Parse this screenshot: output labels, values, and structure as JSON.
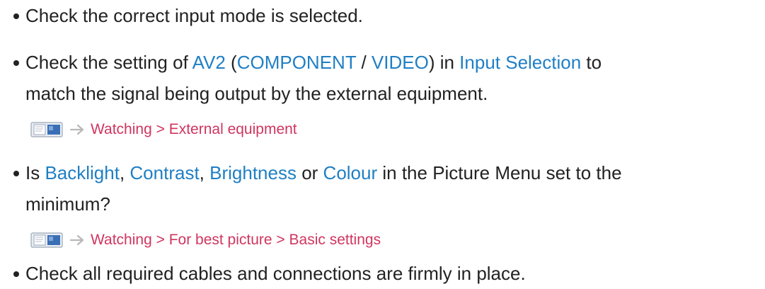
{
  "bullets": [
    {
      "parts": [
        {
          "text": "Check the correct input mode is selected."
        }
      ]
    },
    {
      "line1": [
        {
          "text": "Check the setting of "
        },
        {
          "text": "AV2",
          "link": true
        },
        {
          "text": " ("
        },
        {
          "text": "COMPONENT",
          "link": true
        },
        {
          "text": " / "
        },
        {
          "text": "VIDEO",
          "link": true
        },
        {
          "text": ") in "
        },
        {
          "text": "Input Selection",
          "link": true
        },
        {
          "text": " to"
        }
      ],
      "line2": "match the signal being output by the external equipment."
    },
    {
      "line1": [
        {
          "text": "Is "
        },
        {
          "text": "Backlight",
          "link": true
        },
        {
          "text": ", "
        },
        {
          "text": "Contrast",
          "link": true
        },
        {
          "text": ", "
        },
        {
          "text": "Brightness",
          "link": true
        },
        {
          "text": " or "
        },
        {
          "text": "Colour",
          "link": true
        },
        {
          "text": " in the Picture Menu set to the"
        }
      ],
      "line2": "minimum?"
    },
    {
      "parts": [
        {
          "text": "Check all required cables and connections are firmly in place."
        }
      ]
    }
  ],
  "references": [
    {
      "icon": "ebook-icon",
      "path": "Watching > External equipment"
    },
    {
      "icon": "ebook-icon",
      "path": "Watching > For best picture > Basic settings"
    }
  ],
  "colors": {
    "text": "#222222",
    "link": "#1f7fc4",
    "reference": "#d0355f",
    "icon": "#3a6fb5"
  }
}
